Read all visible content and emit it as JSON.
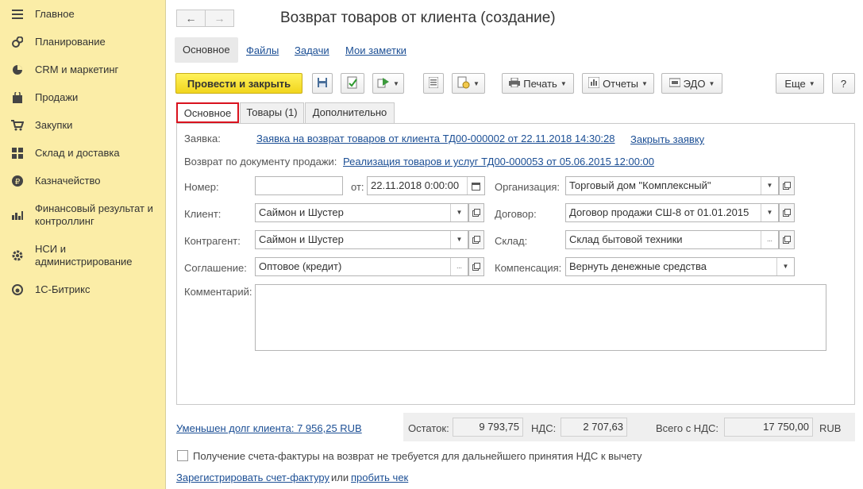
{
  "sidebar": {
    "items": [
      {
        "label": "Главное",
        "icon": "menu-icon"
      },
      {
        "label": "Планирование",
        "icon": "coin-icon"
      },
      {
        "label": "CRM и маркетинг",
        "icon": "pie-chart-icon"
      },
      {
        "label": "Продажи",
        "icon": "shopping-bag-icon"
      },
      {
        "label": "Закупки",
        "icon": "cart-icon"
      },
      {
        "label": "Склад и доставка",
        "icon": "grid-icon"
      },
      {
        "label": "Казначейство",
        "icon": "ruble-icon"
      },
      {
        "label": "Финансовый результат и контроллинг",
        "icon": "bar-chart-icon"
      },
      {
        "label": "НСИ и администрирование",
        "icon": "gear-icon"
      },
      {
        "label": "1С-Битрикс",
        "icon": "bitrix-icon"
      }
    ]
  },
  "header": {
    "title": "Возврат товаров от клиента (создание)",
    "tabs": [
      "Основное",
      "Файлы",
      "Задачи",
      "Мои заметки"
    ]
  },
  "toolbar": {
    "post_close": "Провести и закрыть",
    "print": "Печать",
    "reports": "Отчеты",
    "edo": "ЭДО",
    "more": "Еще",
    "help": "?"
  },
  "form_tabs": [
    "Основное",
    "Товары (1)",
    "Дополнительно"
  ],
  "form": {
    "request_label": "Заявка:",
    "request_link": "Заявка на возврат товаров от клиента ТД00-000002 от 22.11.2018 14:30:28",
    "close_request": "Закрыть заявку",
    "sale_doc_label": "Возврат по документу продажи:",
    "sale_doc_link": "Реализация товаров и услуг ТД00-000053 от 05.06.2015 12:00:00",
    "number_label": "Номер:",
    "number_value": "",
    "from_label": "от:",
    "date_value": "22.11.2018  0:00:00",
    "org_label": "Организация:",
    "org_value": "Торговый дом \"Комплексный\"",
    "client_label": "Клиент:",
    "client_value": "Саймон и Шустер",
    "contract_label": "Договор:",
    "contract_value": "Договор продажи СШ-8 от 01.01.2015",
    "counterparty_label": "Контрагент:",
    "counterparty_value": "Саймон и Шустер",
    "warehouse_label": "Склад:",
    "warehouse_value": "Склад бытовой техники",
    "agreement_label": "Соглашение:",
    "agreement_value": "Оптовое (кредит)",
    "compensation_label": "Компенсация:",
    "compensation_value": "Вернуть денежные средства",
    "comment_label": "Комментарий:",
    "ellipsis": "..."
  },
  "footer": {
    "debt_link": "Уменьшен долг клиента: 7 956,25 RUB",
    "balance_label": "Остаток:",
    "balance_value": "9 793,75",
    "vat_label": "НДС:",
    "vat_value": "2 707,63",
    "total_label": "Всего с НДС:",
    "total_value": "17 750,00",
    "currency": "RUB",
    "invoice_checkbox_label": "Получение счета-фактуры на возврат не требуется для дальнейшего принятия НДС к вычету",
    "register_invoice": "Зарегистрировать счет-фактуру",
    "or": "или",
    "print_check": "пробить чек"
  },
  "colors": {
    "sidebar_bg": "#fbeda7",
    "primary_button": "#f1d51d",
    "link": "#1c4f95",
    "active_tab_border": "#d9121e"
  }
}
